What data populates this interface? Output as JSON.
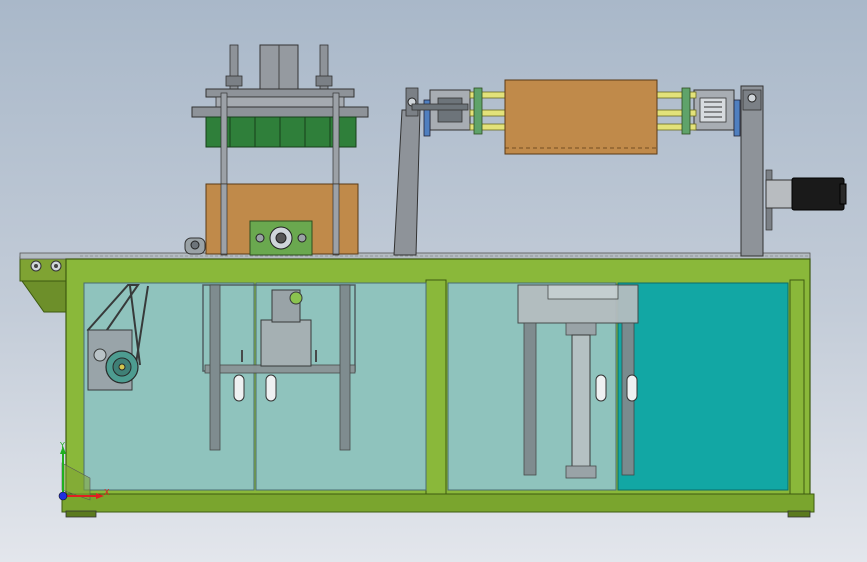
{
  "view": {
    "background_top": "#a9b8c9",
    "background_bottom": "#e3e6ec"
  },
  "colors": {
    "frame_green": "#8ab83a",
    "frame_dark": "#3d5a10",
    "glass": "#8fc3c9",
    "glass_teal": "#12a7a4",
    "wood": "#c08a4a",
    "steel": "#8e9399",
    "yellow_rod": "#e3e27a",
    "motor_black": "#1a1a1a"
  },
  "axis_triad": {
    "x_label": "X",
    "y_label": "Y",
    "x_color": "#e02020",
    "y_color": "#20b020",
    "z_color": "#2030e0"
  }
}
